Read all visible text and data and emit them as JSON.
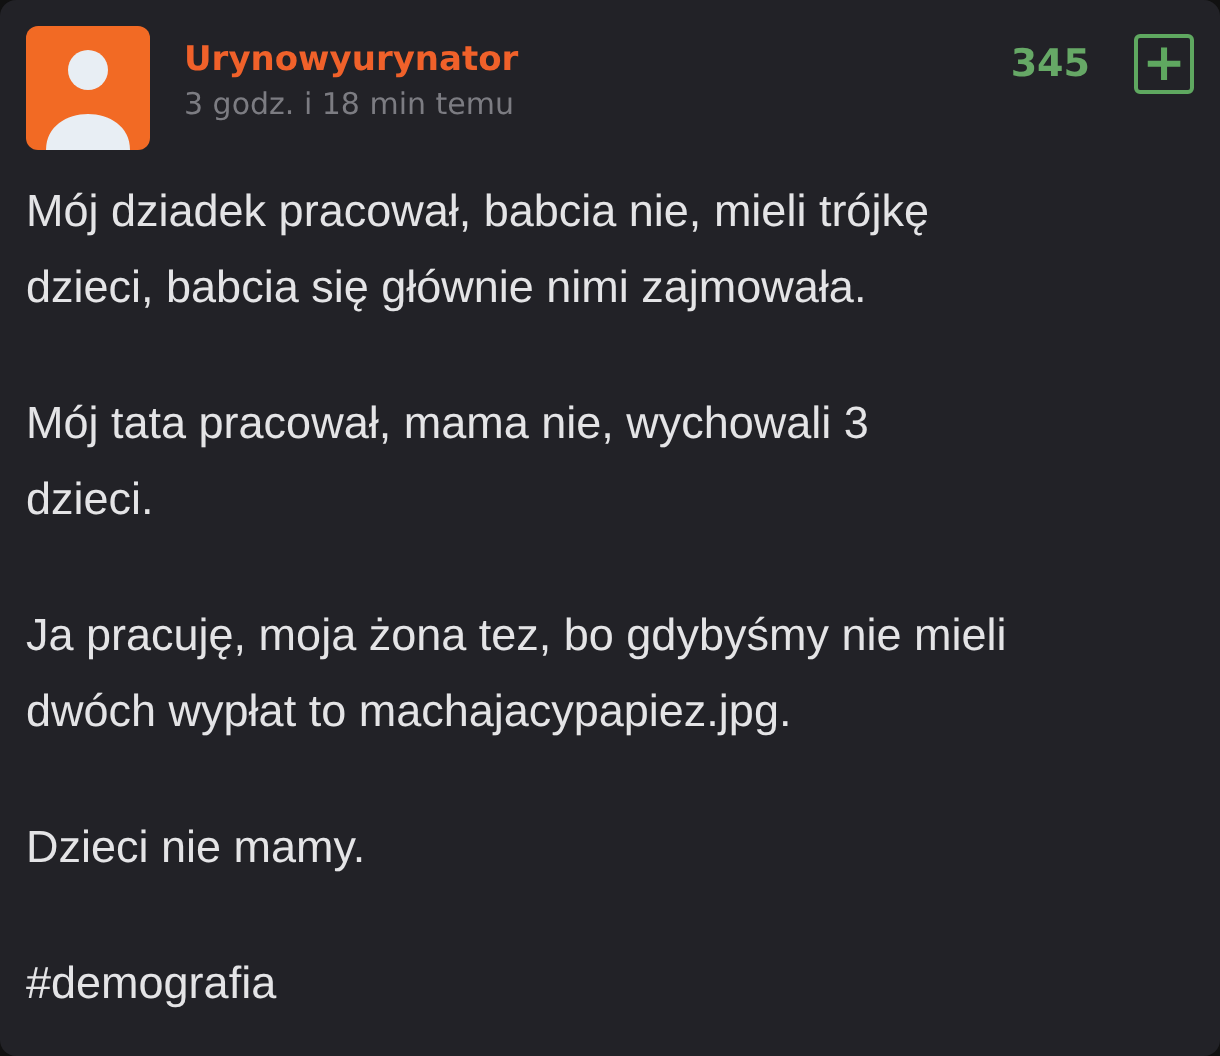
{
  "post": {
    "author": "Urynowyurynator",
    "time": "3 godz. i 18 min temu",
    "votes": "345",
    "vote_button": "+",
    "paragraphs": [
      {
        "lines": [
          "Mój dziadek pracował, babcia nie, mieli trójkę",
          "dzieci, babcia się głównie nimi zajmowała."
        ]
      },
      {
        "lines": [
          "Mój tata pracował, mama nie, wychowali 3",
          "dzieci."
        ]
      },
      {
        "lines": [
          "Ja pracuję, moja żona tez, bo gdybyśmy nie mieli",
          "dwóch wypłat to machajacypapiez.jpg."
        ]
      },
      {
        "lines": [
          "Dzieci nie mamy."
        ]
      }
    ],
    "hashtag": "#demografia"
  }
}
